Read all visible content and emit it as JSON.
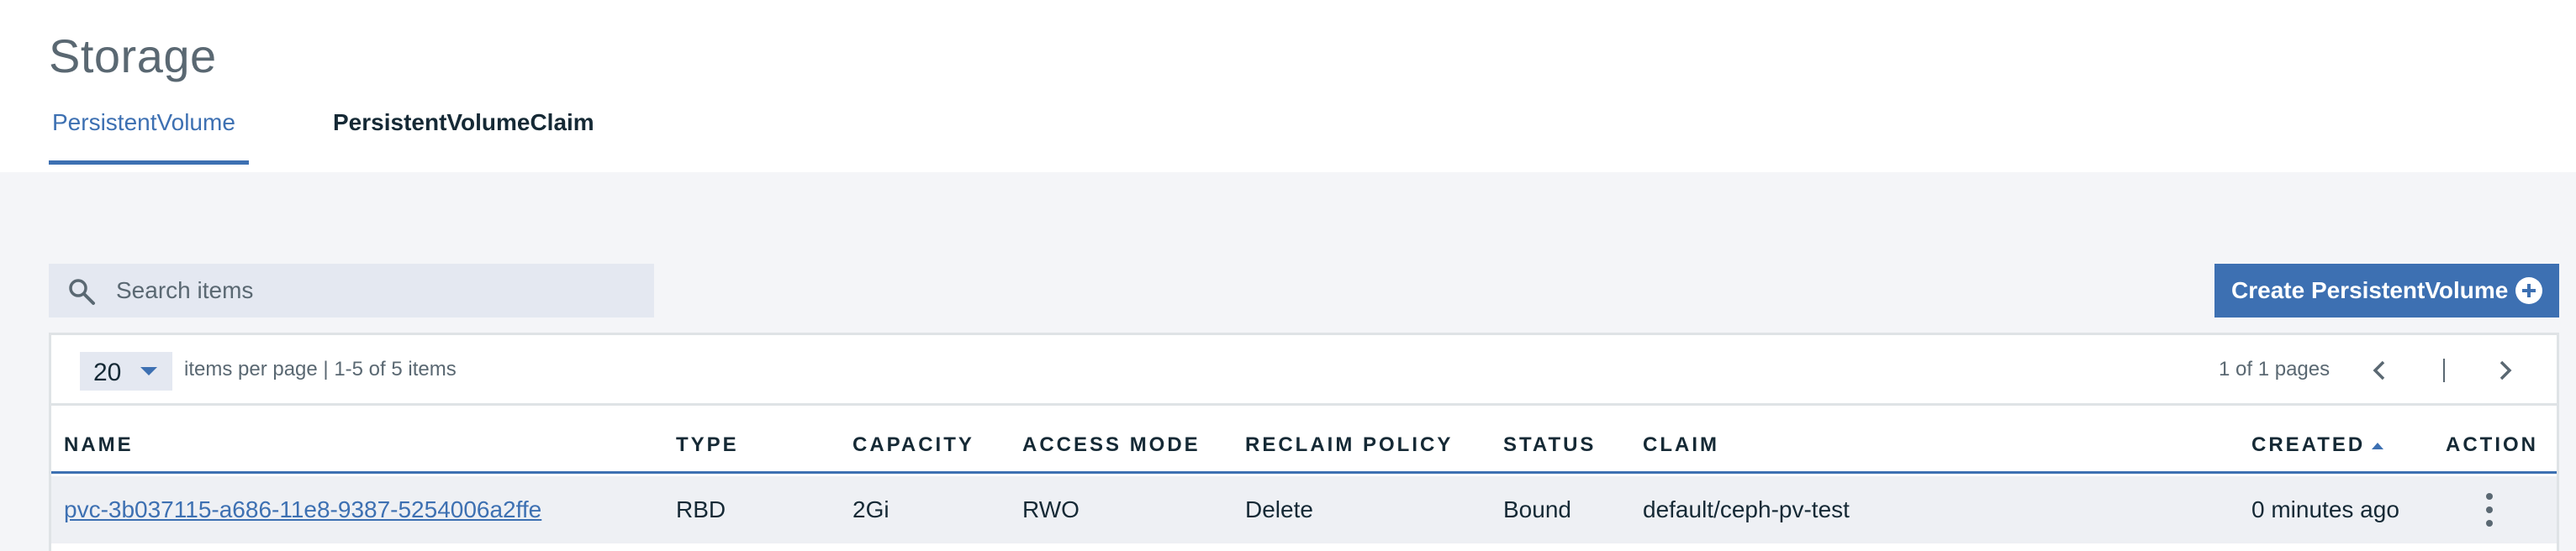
{
  "page": {
    "title": "Storage"
  },
  "tabs": [
    {
      "label": "PersistentVolume",
      "active": true
    },
    {
      "label": "PersistentVolumeClaim",
      "active": false
    }
  ],
  "search": {
    "placeholder": "Search items",
    "value": ""
  },
  "create_button": {
    "label": "Create PersistentVolume",
    "icon": "add-filled-icon"
  },
  "pagination": {
    "per_page": "20",
    "per_page_label": "items per page  |  1-5 of 5 items",
    "pages_label": "1 of 1 pages",
    "separator": "|"
  },
  "table": {
    "columns": [
      "NAME",
      "TYPE",
      "CAPACITY",
      "ACCESS MODE",
      "RECLAIM POLICY",
      "STATUS",
      "CLAIM",
      "CREATED",
      "ACTION"
    ],
    "sorted_column": "CREATED",
    "sort_direction": "ascending",
    "rows": [
      {
        "name": "pvc-3b037115-a686-11e8-9387-5254006a2ffe",
        "type": "RBD",
        "capacity": "2Gi",
        "access_mode": "RWO",
        "reclaim_policy": "Delete",
        "status": "Bound",
        "claim": "default/ceph-pv-test",
        "created": "0 minutes ago"
      }
    ]
  },
  "colors": {
    "accent": "#3d70b2",
    "text": "#152935",
    "muted": "#5a6872",
    "background": "#f4f5f8"
  }
}
